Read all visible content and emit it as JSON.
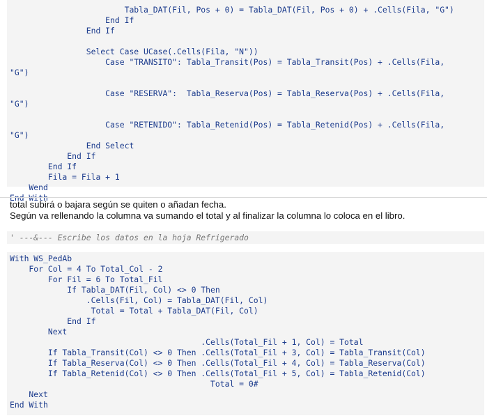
{
  "code_top": [
    "                        Tabla_DAT(Fil, Pos + 0) = Tabla_DAT(Fil, Pos + 0) + .Cells(Fila, \"G\")",
    "                    End If",
    "                End If",
    "",
    "                Select Case UCase(.Cells(Fila, \"N\"))",
    "                    Case \"TRANSITO\": Tabla_Transit(Pos) = Tabla_Transit(Pos) + .Cells(Fila,",
    "\"G\")",
    "",
    "                    Case \"RESERVA\":  Tabla_Reserva(Pos) = Tabla_Reserva(Pos) + .Cells(Fila,",
    "\"G\")",
    "",
    "                    Case \"RETENIDO\": Tabla_Retenid(Pos) = Tabla_Retenid(Pos) + .Cells(Fila,",
    "\"G\")",
    "                End Select",
    "            End If",
    "        End If",
    "        Fila = Fila + 1",
    "    Wend",
    "End With"
  ],
  "prose": [
    "total subirá o bajara según se quiten o añadan fecha.",
    "Según va rellenando la columna va sumando el total y al finalizar la columna lo coloca en el libro."
  ],
  "comment": "' ---&--- Escribe los datos en la hoja Refrigerado",
  "code_bottom": [
    "With WS_PedAb",
    "    For Col = 4 To Total_Col - 2",
    "        For Fil = 6 To Total_Fil",
    "            If Tabla_DAT(Fil, Col) <> 0 Then",
    "                .Cells(Fil, Col) = Tabla_DAT(Fil, Col)",
    "                 Total = Total + Tabla_DAT(Fil, Col)",
    "            End If",
    "        Next",
    "                                        .Cells(Total_Fil + 1, Col) = Total",
    "        If Tabla_Transit(Col) <> 0 Then .Cells(Total_Fil + 3, Col) = Tabla_Transit(Col)",
    "        If Tabla_Reserva(Col) <> 0 Then .Cells(Total_Fil + 4, Col) = Tabla_Reserva(Col)",
    "        If Tabla_Retenid(Col) <> 0 Then .Cells(Total_Fil + 5, Col) = Tabla_Retenid(Col)",
    "                                          Total = 0#",
    "    Next",
    "End With"
  ]
}
